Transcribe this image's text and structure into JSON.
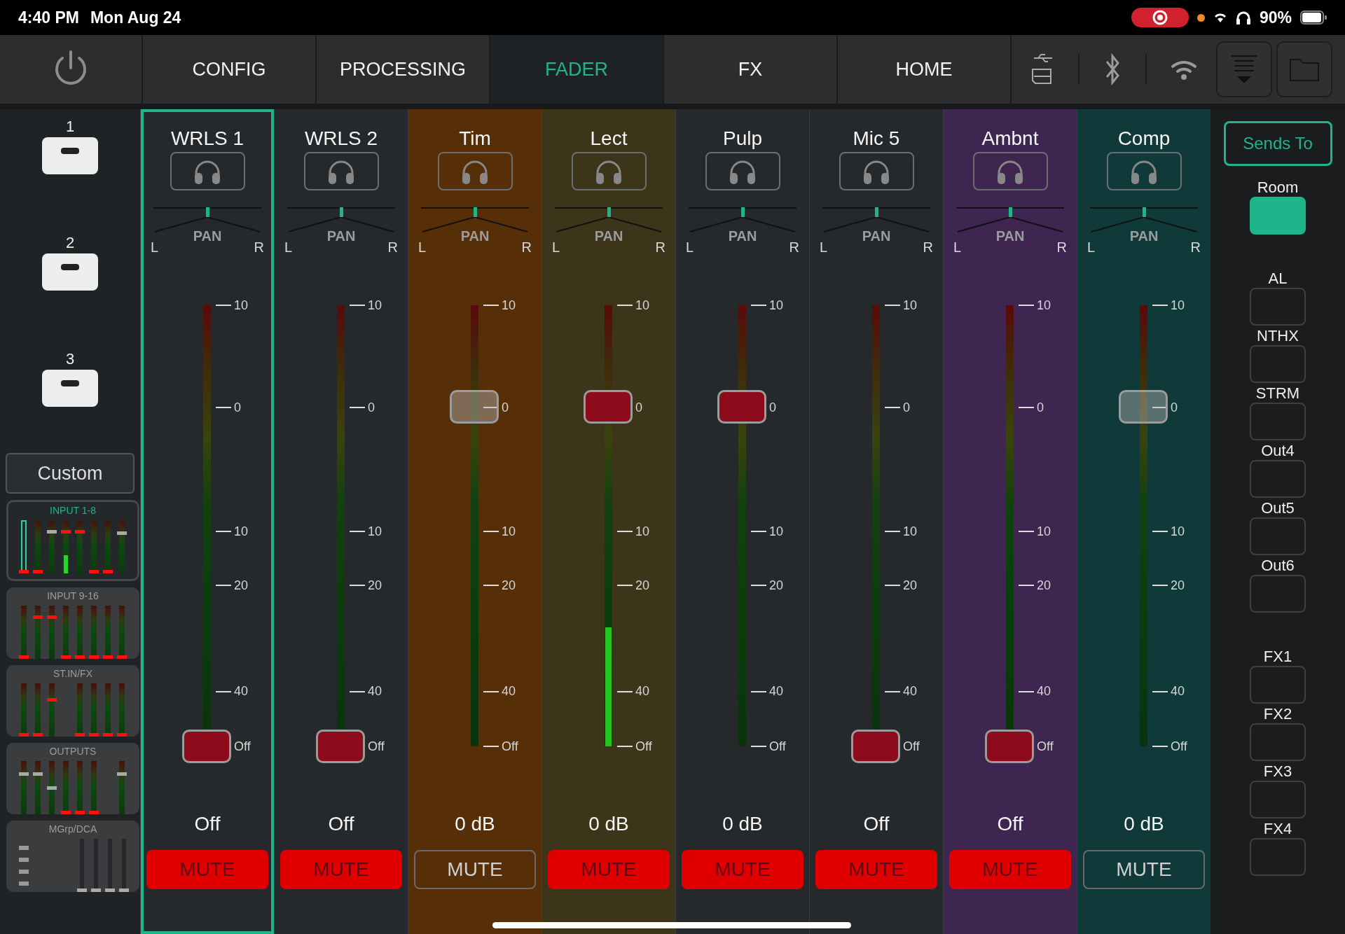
{
  "status_bar": {
    "time": "4:40 PM",
    "date": "Mon Aug 24",
    "recording": true,
    "battery": "90%"
  },
  "nav": {
    "tabs": [
      {
        "label": "CONFIG",
        "selected": false
      },
      {
        "label": "PROCESSING",
        "selected": false
      },
      {
        "label": "FADER",
        "selected": true
      },
      {
        "label": "FX",
        "selected": false
      },
      {
        "label": "HOME",
        "selected": false
      }
    ]
  },
  "sidebar": {
    "user_keys": [
      {
        "label": "1"
      },
      {
        "label": "2"
      },
      {
        "label": "3"
      }
    ],
    "custom_button": "Custom",
    "banks": [
      {
        "label": "INPUT 1-8",
        "selected": true,
        "faders": [
          {
            "kind": "channel",
            "level": 0,
            "muted": true,
            "selected": true
          },
          {
            "kind": "channel",
            "level": 0,
            "muted": true,
            "selected": false
          },
          {
            "kind": "channel",
            "level": 0.8,
            "muted": false,
            "selected": false
          },
          {
            "kind": "channel",
            "level": 0.8,
            "muted": true,
            "selected": false,
            "meter": {
              "level": 0.34
            }
          },
          {
            "kind": "channel",
            "level": 0.8,
            "muted": true,
            "selected": false
          },
          {
            "kind": "channel",
            "level": 0,
            "muted": true,
            "selected": false
          },
          {
            "kind": "channel",
            "level": 0,
            "muted": true,
            "selected": false
          },
          {
            "kind": "channel",
            "level": 0.78,
            "muted": false,
            "selected": false
          }
        ]
      },
      {
        "label": "INPUT 9-16",
        "selected": false,
        "faders": [
          {
            "kind": "channel",
            "level": 0,
            "muted": true
          },
          {
            "kind": "channel",
            "level": 0.8,
            "muted": true
          },
          {
            "kind": "channel",
            "level": 0.8,
            "muted": true
          },
          {
            "kind": "channel",
            "level": 0,
            "muted": true
          },
          {
            "kind": "channel",
            "level": 0,
            "muted": true
          },
          {
            "kind": "channel",
            "level": 0,
            "muted": true
          },
          {
            "kind": "channel",
            "level": 0,
            "muted": true
          },
          {
            "kind": "channel",
            "level": 0,
            "muted": true
          }
        ]
      },
      {
        "label": "ST.IN/FX",
        "selected": false,
        "faders": [
          {
            "kind": "channel",
            "level": 0,
            "muted": true
          },
          {
            "kind": "channel",
            "level": 0,
            "muted": true
          },
          {
            "kind": "channel",
            "level": 0.7,
            "muted": true
          },
          {
            "kind": "empty"
          },
          {
            "kind": "channel",
            "level": 0,
            "muted": true
          },
          {
            "kind": "channel",
            "level": 0,
            "muted": true
          },
          {
            "kind": "channel",
            "level": 0,
            "muted": true
          },
          {
            "kind": "channel",
            "level": 0,
            "muted": true
          }
        ]
      },
      {
        "label": "OUTPUTS",
        "selected": false,
        "faders": [
          {
            "kind": "channel",
            "level": 0.78,
            "muted": false
          },
          {
            "kind": "channel",
            "level": 0.77,
            "muted": false
          },
          {
            "kind": "channel",
            "level": 0.49,
            "muted": false
          },
          {
            "kind": "channel",
            "level": 0,
            "muted": true
          },
          {
            "kind": "channel",
            "level": 0,
            "muted": true
          },
          {
            "kind": "channel",
            "level": 0,
            "muted": true
          },
          {
            "kind": "empty"
          },
          {
            "kind": "channel",
            "level": 0.78,
            "muted": false
          }
        ]
      },
      {
        "label": "MGrp/DCA",
        "selected": false,
        "faders": [
          {
            "kind": "groups"
          },
          {
            "kind": "empty"
          },
          {
            "kind": "empty"
          },
          {
            "kind": "empty"
          },
          {
            "kind": "dca",
            "level": 0,
            "muted": false
          },
          {
            "kind": "dca",
            "level": 0,
            "muted": false
          },
          {
            "kind": "dca",
            "level": 0,
            "muted": false
          },
          {
            "kind": "dca",
            "level": 0,
            "muted": false
          }
        ]
      }
    ]
  },
  "channels": [
    {
      "name": "WRLS 1",
      "selected": true,
      "color": "#25292b",
      "pan": {
        "level": 0.5,
        "label": "PAN",
        "left": "L",
        "right": "R"
      },
      "scale": [
        "10",
        "0",
        "10",
        "20",
        "40",
        "Off"
      ],
      "meter": {
        "level": 0
      },
      "fader": {
        "level": 0
      },
      "value": "Off",
      "mute": {
        "label": "MUTE",
        "on": true
      }
    },
    {
      "name": "WRLS 2",
      "selected": false,
      "color": "#25292b",
      "pan": {
        "level": 0.5,
        "label": "PAN",
        "left": "L",
        "right": "R"
      },
      "scale": [
        "10",
        "0",
        "10",
        "20",
        "40",
        "Off"
      ],
      "meter": {
        "level": 0
      },
      "fader": {
        "level": 0
      },
      "value": "Off",
      "mute": {
        "label": "MUTE",
        "on": true
      }
    },
    {
      "name": "Tim",
      "selected": false,
      "color": "#562e08",
      "pan": {
        "level": 0.5,
        "label": "PAN",
        "left": "L",
        "right": "R"
      },
      "scale": [
        "10",
        "0",
        "10",
        "20",
        "40",
        "Off"
      ],
      "meter": {
        "level": 0
      },
      "fader": {
        "level": 0.77
      },
      "value": "0 dB",
      "mute": {
        "label": "MUTE",
        "on": false
      }
    },
    {
      "name": "Lect",
      "selected": false,
      "color": "#3d3519",
      "pan": {
        "level": 0.5,
        "label": "PAN",
        "left": "L",
        "right": "R"
      },
      "scale": [
        "10",
        "0",
        "10",
        "20",
        "40",
        "Off"
      ],
      "meter": {
        "level": 0.27
      },
      "fader": {
        "level": 0.77
      },
      "value": "0 dB",
      "mute": {
        "label": "MUTE",
        "on": true
      }
    },
    {
      "name": "Pulp",
      "selected": false,
      "color": "#25292b",
      "pan": {
        "level": 0.5,
        "label": "PAN",
        "left": "L",
        "right": "R"
      },
      "scale": [
        "10",
        "0",
        "10",
        "20",
        "40",
        "Off"
      ],
      "meter": {
        "level": 0
      },
      "fader": {
        "level": 0.77
      },
      "value": "0 dB",
      "mute": {
        "label": "MUTE",
        "on": true
      }
    },
    {
      "name": "Mic 5",
      "selected": false,
      "color": "#25292b",
      "pan": {
        "level": 0.5,
        "label": "PAN",
        "left": "L",
        "right": "R"
      },
      "scale": [
        "10",
        "0",
        "10",
        "20",
        "40",
        "Off"
      ],
      "meter": {
        "level": 0
      },
      "fader": {
        "level": 0
      },
      "value": "Off",
      "mute": {
        "label": "MUTE",
        "on": true
      }
    },
    {
      "name": "Ambnt",
      "selected": false,
      "color": "#3e2650",
      "pan": {
        "level": 0.5,
        "label": "PAN",
        "left": "L",
        "right": "R"
      },
      "scale": [
        "10",
        "0",
        "10",
        "20",
        "40",
        "Off"
      ],
      "meter": {
        "level": 0
      },
      "fader": {
        "level": 0
      },
      "value": "Off",
      "mute": {
        "label": "MUTE",
        "on": true
      }
    },
    {
      "name": "Comp",
      "selected": false,
      "color": "#0f3a39",
      "pan": {
        "level": 0.5,
        "label": "PAN",
        "left": "L",
        "right": "R"
      },
      "scale": [
        "10",
        "0",
        "10",
        "20",
        "40",
        "Off"
      ],
      "meter": {
        "level": 0
      },
      "fader": {
        "level": 0.77
      },
      "value": "0 dB",
      "mute": {
        "label": "MUTE",
        "on": false
      }
    }
  ],
  "sends_panel": {
    "button": "Sends To",
    "sends": [
      {
        "label": "Room",
        "selected": true
      },
      {
        "label": "AL",
        "selected": false
      },
      {
        "label": "NTHX",
        "selected": false
      },
      {
        "label": "STRM",
        "selected": false
      },
      {
        "label": "Out4",
        "selected": false
      },
      {
        "label": "Out5",
        "selected": false
      },
      {
        "label": "Out6",
        "selected": false
      }
    ],
    "fx_sends": [
      {
        "label": "FX1",
        "selected": false
      },
      {
        "label": "FX2",
        "selected": false
      },
      {
        "label": "FX3",
        "selected": false
      },
      {
        "label": "FX4",
        "selected": false
      }
    ]
  }
}
